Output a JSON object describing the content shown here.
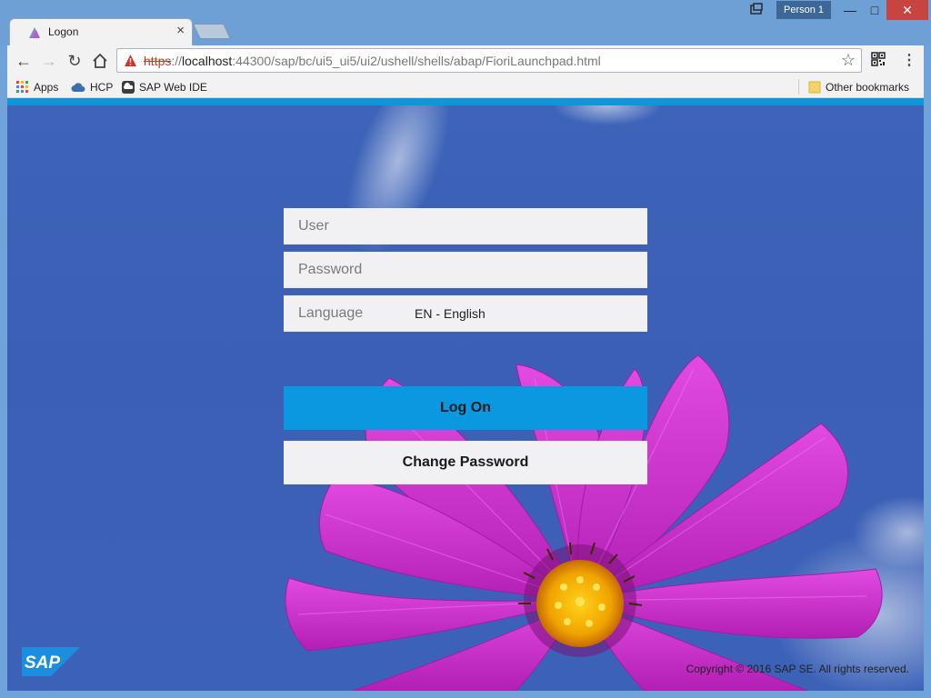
{
  "browser": {
    "tab_title": "Logon",
    "tab_close": "×",
    "profile_name": "Person 1",
    "url": {
      "scheme": "https",
      "separator": "://",
      "host": "localhost",
      "path": ":44300/sap/bc/ui5_ui5/ui2/ushell/shells/abap/FioriLaunchpad.html"
    },
    "bookmarks": [
      {
        "label": "Apps",
        "icon": "apps-grid-icon"
      },
      {
        "label": "HCP",
        "icon": "cloud-icon"
      },
      {
        "label": "SAP Web IDE",
        "icon": "web-ide-icon"
      }
    ],
    "other_bookmarks": "Other bookmarks"
  },
  "login": {
    "user_placeholder": "User",
    "password_placeholder": "Password",
    "language_label": "Language",
    "language_value": "EN - English",
    "logon_label": "Log On",
    "change_password_label": "Change Password"
  },
  "footer": {
    "logo_text": "SAP",
    "copyright": "Copyright © 2016 SAP SE. All rights reserved."
  },
  "colors": {
    "brand_blue": "#0a99e0",
    "background_blue": "#3d64b8",
    "flower_magenta": "#d22fd0"
  }
}
